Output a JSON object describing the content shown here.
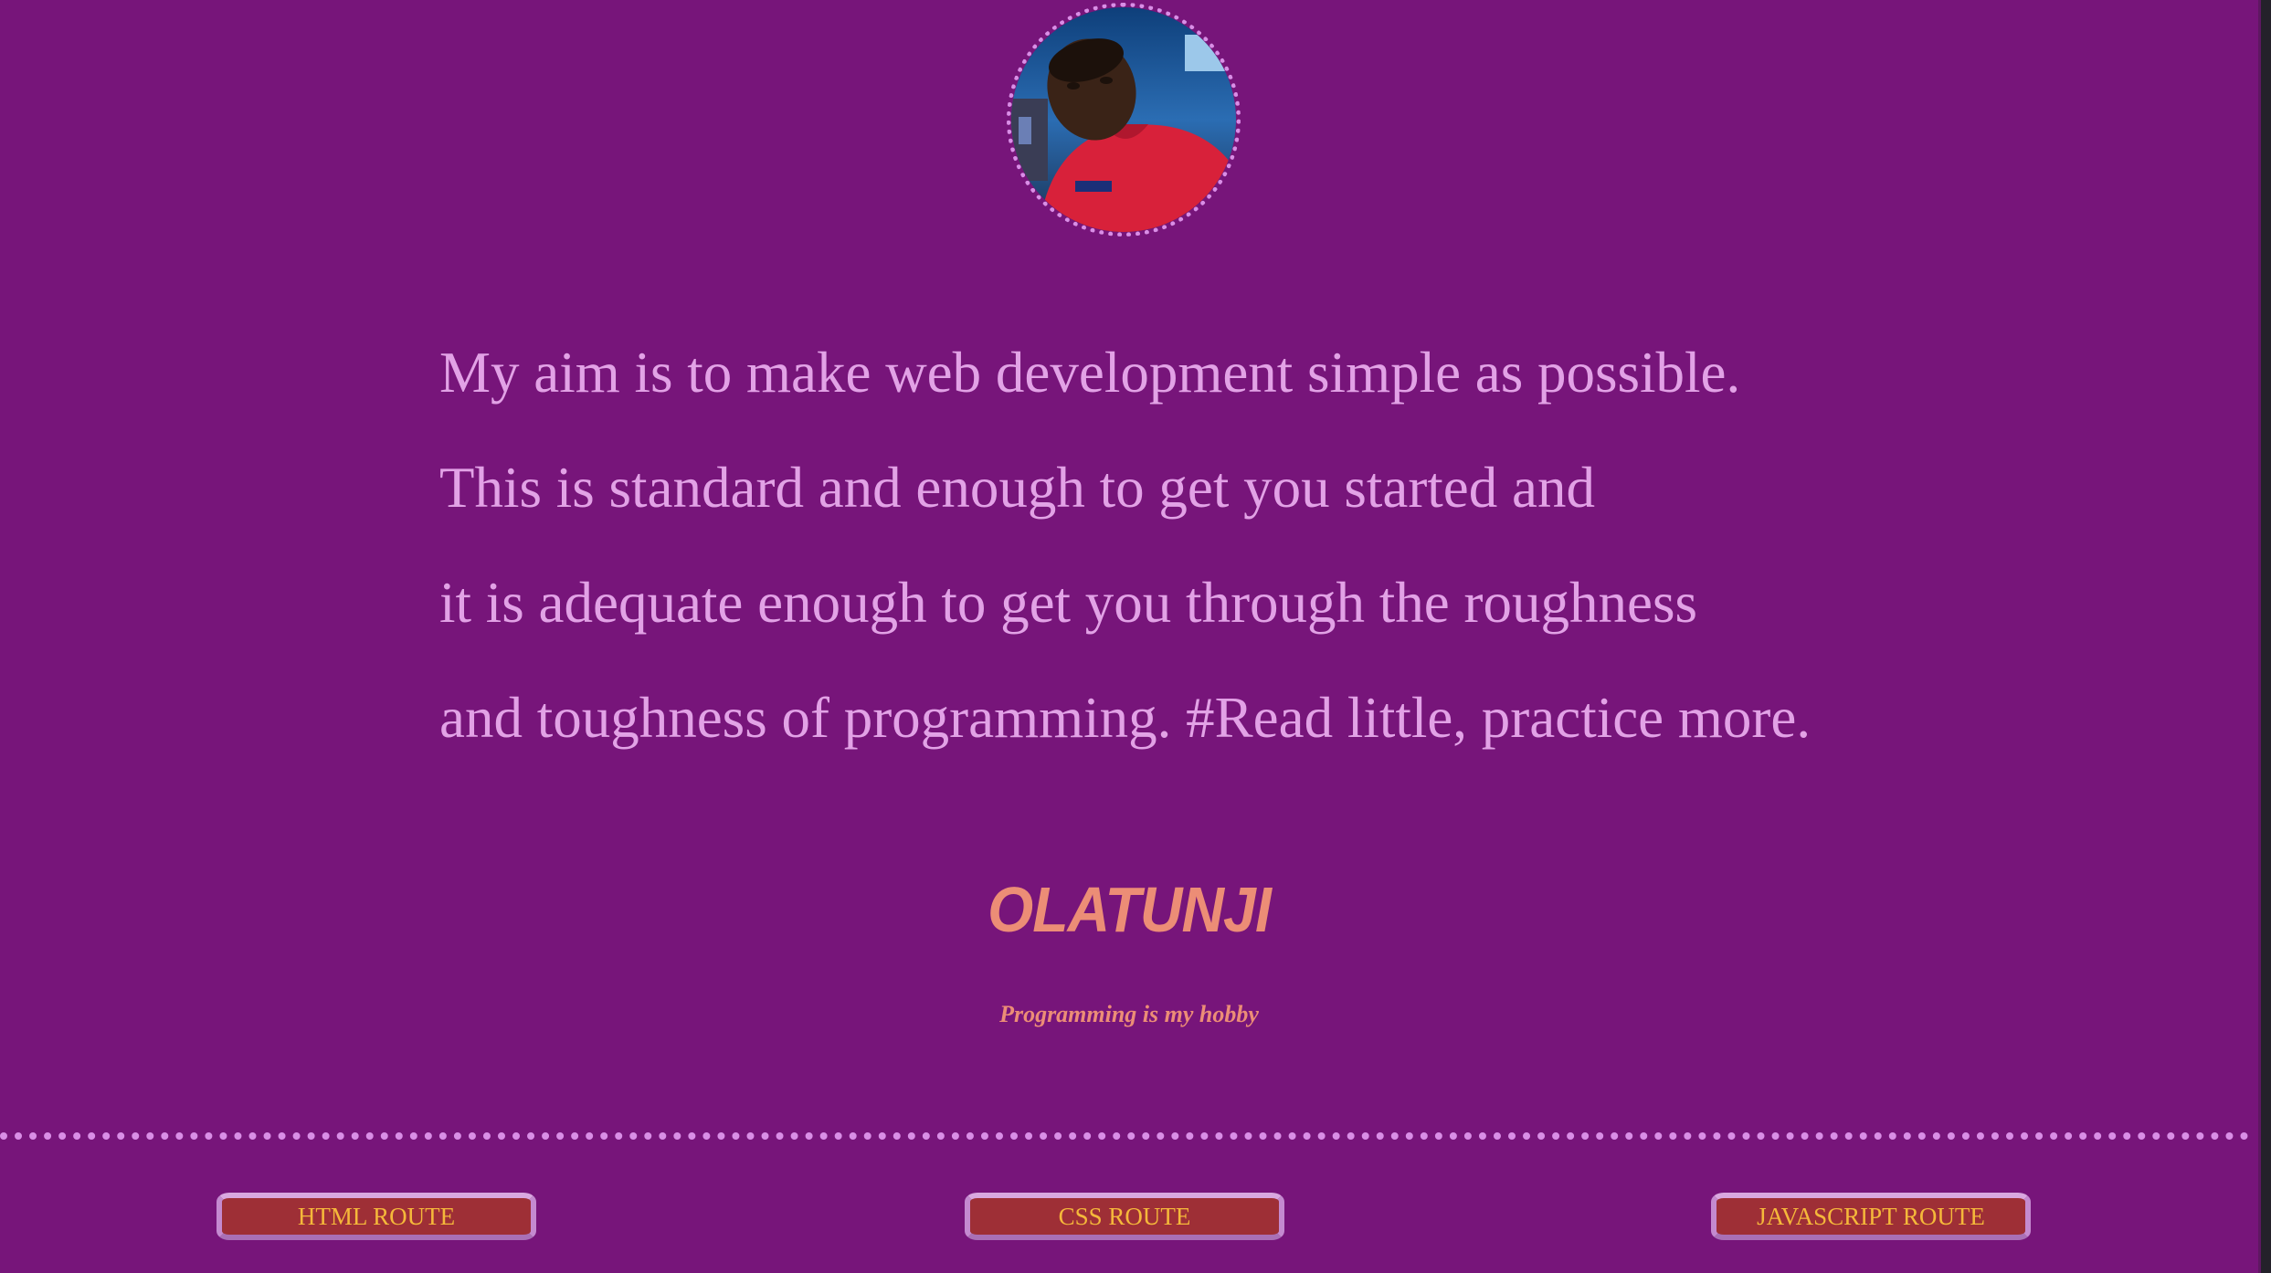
{
  "profile": {
    "avatar_alt": "profile photo"
  },
  "quote": {
    "lines": [
      "My aim is to make web development simple as possible.",
      "This is standard and enough to get you started and",
      "it is adequate enough to get you through the roughness",
      "and toughness of programming. #Read little, practice more."
    ]
  },
  "name": "OLATUNJI",
  "tagline": "Programming is my hobby",
  "routes": [
    {
      "label": "HTML ROUTE"
    },
    {
      "label": "CSS ROUTE"
    },
    {
      "label": "JAVASCRIPT ROUTE"
    }
  ],
  "colors": {
    "background": "#77157a",
    "quote_text": "#e2a2e6",
    "name_text": "#ec8d76",
    "button_bg": "#9e2f36",
    "button_text": "#f5b83a",
    "dots": "#d98ee6"
  }
}
